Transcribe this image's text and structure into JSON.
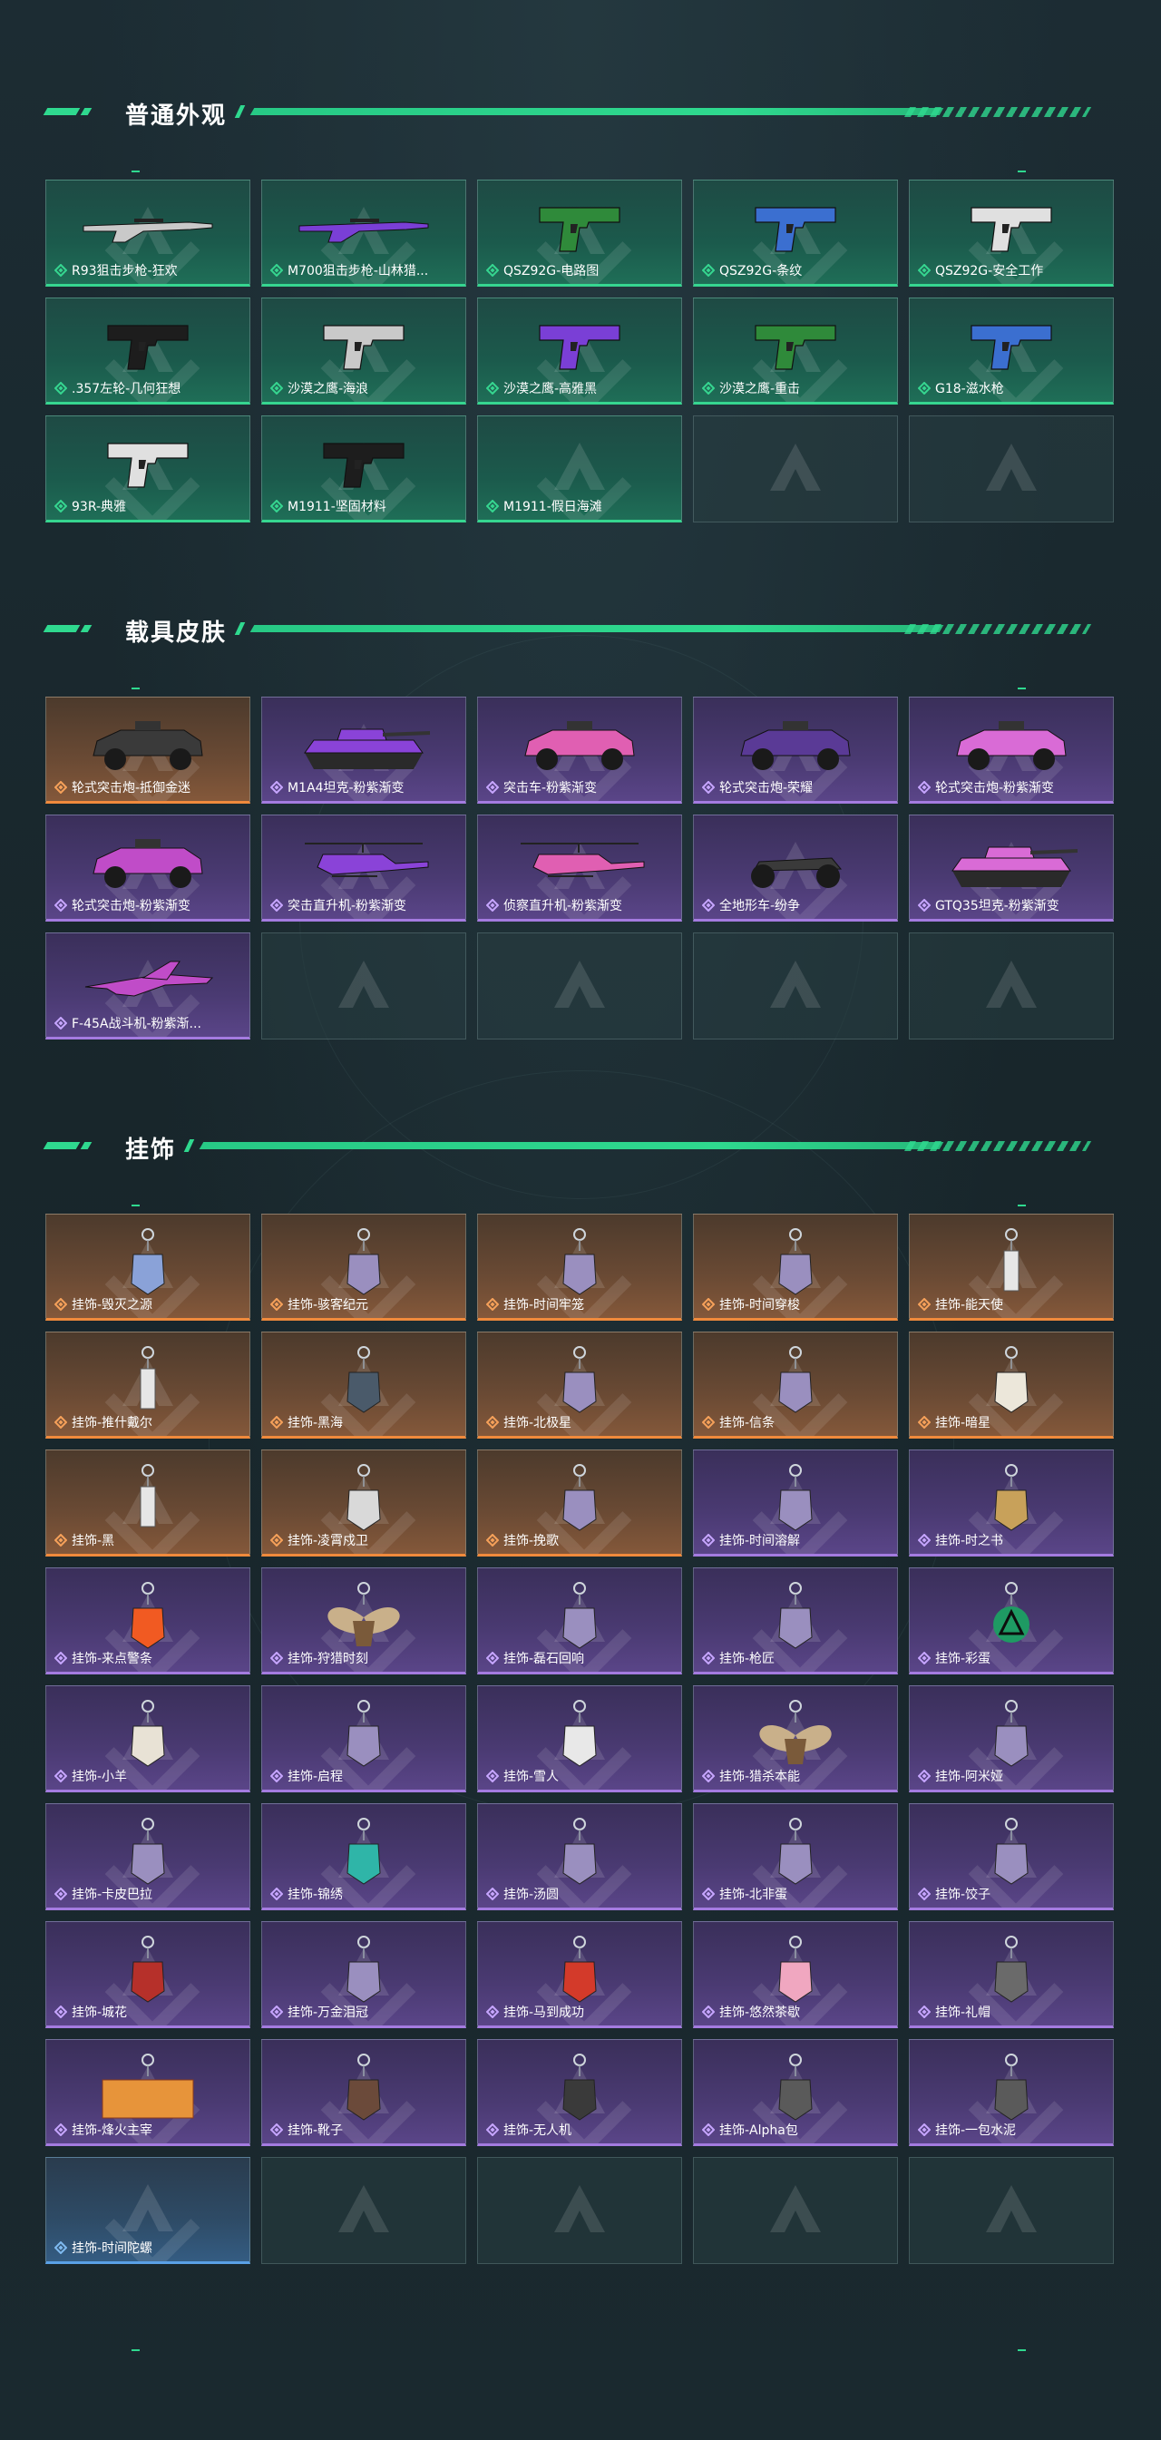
{
  "colors": {
    "accent": "#2fd98f",
    "rarity_green": "#36d690",
    "rarity_purple": "#a47be0",
    "rarity_orange": "#f08a3c",
    "rarity_blue": "#5aa0e6"
  },
  "sections": [
    {
      "title": "普通外观",
      "items": [
        {
          "label": "R93狙击步枪-狂欢",
          "rarity": "green",
          "icon": "rifle-icon"
        },
        {
          "label": "M700狙击步枪-山林猎...",
          "rarity": "green",
          "icon": "rifle-icon"
        },
        {
          "label": "QSZ92G-电路图",
          "rarity": "green",
          "icon": "pistol-icon"
        },
        {
          "label": "QSZ92G-条纹",
          "rarity": "green",
          "icon": "pistol-icon"
        },
        {
          "label": "QSZ92G-安全工作",
          "rarity": "green",
          "icon": "pistol-icon"
        },
        {
          "label": ".357左轮-几何狂想",
          "rarity": "green",
          "icon": "revolver-icon"
        },
        {
          "label": "沙漠之鹰-海浪",
          "rarity": "green",
          "icon": "pistol-icon"
        },
        {
          "label": "沙漠之鹰-高雅黑",
          "rarity": "green",
          "icon": "pistol-icon"
        },
        {
          "label": "沙漠之鹰-重击",
          "rarity": "green",
          "icon": "pistol-icon"
        },
        {
          "label": "G18-滋水枪",
          "rarity": "green",
          "icon": "pistol-icon"
        },
        {
          "label": "93R-典雅",
          "rarity": "green",
          "icon": "pistol-icon"
        },
        {
          "label": "M1911-坚固材料",
          "rarity": "green",
          "icon": "pistol-icon"
        },
        {
          "label": "M1911-假日海滩",
          "rarity": "green",
          "icon": "none"
        }
      ]
    },
    {
      "title": "载具皮肤",
      "items": [
        {
          "label": "轮式突击炮-抵御金迷",
          "rarity": "orange",
          "icon": "armored-vehicle-icon"
        },
        {
          "label": "M1A4坦克-粉紫渐变",
          "rarity": "purple",
          "icon": "tank-icon"
        },
        {
          "label": "突击车-粉紫渐变",
          "rarity": "purple",
          "icon": "armored-vehicle-icon"
        },
        {
          "label": "轮式突击炮-荣耀",
          "rarity": "purple",
          "icon": "armored-vehicle-icon"
        },
        {
          "label": "轮式突击炮-粉紫渐变",
          "rarity": "purple",
          "icon": "armored-vehicle-icon"
        },
        {
          "label": "轮式突击炮-粉紫渐变",
          "rarity": "purple",
          "icon": "armored-vehicle-icon"
        },
        {
          "label": "突击直升机-粉紫渐变",
          "rarity": "purple",
          "icon": "helicopter-icon"
        },
        {
          "label": "侦察直升机-粉紫渐变",
          "rarity": "purple",
          "icon": "helicopter-icon"
        },
        {
          "label": "全地形车-纷争",
          "rarity": "purple",
          "icon": "atv-icon"
        },
        {
          "label": "GTQ35坦克-粉紫渐变",
          "rarity": "purple",
          "icon": "tank-icon"
        },
        {
          "label": "F-45A战斗机-粉紫渐...",
          "rarity": "purple",
          "icon": "jet-icon"
        }
      ]
    },
    {
      "title": "挂饰",
      "items": [
        {
          "label": "挂饰-毁灭之源",
          "rarity": "orange",
          "icon": "dragon-charm-icon"
        },
        {
          "label": "挂饰-骇客纪元",
          "rarity": "orange",
          "icon": "charm-icon"
        },
        {
          "label": "挂饰-时间牢笼",
          "rarity": "orange",
          "icon": "charm-icon"
        },
        {
          "label": "挂饰-时间穿梭",
          "rarity": "orange",
          "icon": "charm-icon"
        },
        {
          "label": "挂饰-能天使",
          "rarity": "orange",
          "icon": "tag-charm-icon"
        },
        {
          "label": "挂饰-推什戴尔",
          "rarity": "orange",
          "icon": "tag-charm-icon"
        },
        {
          "label": "挂饰-黑海",
          "rarity": "orange",
          "icon": "anchor-charm-icon"
        },
        {
          "label": "挂饰-北极星",
          "rarity": "orange",
          "icon": "charm-icon"
        },
        {
          "label": "挂饰-信条",
          "rarity": "orange",
          "icon": "charm-icon"
        },
        {
          "label": "挂饰-暗星",
          "rarity": "orange",
          "icon": "bird-charm-icon"
        },
        {
          "label": "挂饰-黑",
          "rarity": "orange",
          "icon": "tag-charm-icon"
        },
        {
          "label": "挂饰-凌霄戍卫",
          "rarity": "orange",
          "icon": "eagle-charm-icon"
        },
        {
          "label": "挂饰-挽歌",
          "rarity": "orange",
          "icon": "charm-icon"
        },
        {
          "label": "挂饰-时间溶解",
          "rarity": "purple",
          "icon": "charm-icon"
        },
        {
          "label": "挂饰-时之书",
          "rarity": "purple",
          "icon": "book-charm-icon"
        },
        {
          "label": "挂饰-来点警条",
          "rarity": "purple",
          "icon": "fire-charm-icon"
        },
        {
          "label": "挂饰-狩猎时刻",
          "rarity": "purple",
          "icon": "antler-charm-icon"
        },
        {
          "label": "挂饰-磊石回响",
          "rarity": "purple",
          "icon": "charm-icon"
        },
        {
          "label": "挂饰-枪匠",
          "rarity": "purple",
          "icon": "charm-icon"
        },
        {
          "label": "挂饰-彩蛋",
          "rarity": "purple",
          "icon": "triangle-charm-icon"
        },
        {
          "label": "挂饰-小羊",
          "rarity": "purple",
          "icon": "sheep-charm-icon"
        },
        {
          "label": "挂饰-启程",
          "rarity": "purple",
          "icon": "charm-icon"
        },
        {
          "label": "挂饰-雪人",
          "rarity": "purple",
          "icon": "snowman-charm-icon"
        },
        {
          "label": "挂饰-猎杀本能",
          "rarity": "purple",
          "icon": "antler-charm-icon"
        },
        {
          "label": "挂饰-阿米娅",
          "rarity": "purple",
          "icon": "charm-icon"
        },
        {
          "label": "挂饰-卡皮巴拉",
          "rarity": "purple",
          "icon": "charm-icon"
        },
        {
          "label": "挂饰-锦绣",
          "rarity": "purple",
          "icon": "butterfly-charm-icon"
        },
        {
          "label": "挂饰-汤圆",
          "rarity": "purple",
          "icon": "charm-icon"
        },
        {
          "label": "挂饰-北非蛋",
          "rarity": "purple",
          "icon": "charm-icon"
        },
        {
          "label": "挂饰-饺子",
          "rarity": "purple",
          "icon": "charm-icon"
        },
        {
          "label": "挂饰-城花",
          "rarity": "purple",
          "icon": "flower-charm-icon"
        },
        {
          "label": "挂饰-万金泪冠",
          "rarity": "purple",
          "icon": "charm-icon"
        },
        {
          "label": "挂饰-马到成功",
          "rarity": "purple",
          "icon": "horse-charm-icon"
        },
        {
          "label": "挂饰-悠然茶歇",
          "rarity": "purple",
          "icon": "cupcake-charm-icon"
        },
        {
          "label": "挂饰-礼帽",
          "rarity": "purple",
          "icon": "hat-charm-icon"
        },
        {
          "label": "挂饰-烽火主宰",
          "rarity": "purple",
          "icon": "container-charm-icon"
        },
        {
          "label": "挂饰-靴子",
          "rarity": "purple",
          "icon": "boot-charm-icon"
        },
        {
          "label": "挂饰-无人机",
          "rarity": "purple",
          "icon": "drone-charm-icon"
        },
        {
          "label": "挂饰-Alpha包",
          "rarity": "purple",
          "icon": "bag-charm-icon"
        },
        {
          "label": "挂饰-一包水泥",
          "rarity": "purple",
          "icon": "bag-charm-icon"
        },
        {
          "label": "挂饰-时间陀螺",
          "rarity": "blue",
          "icon": "none"
        }
      ]
    }
  ]
}
